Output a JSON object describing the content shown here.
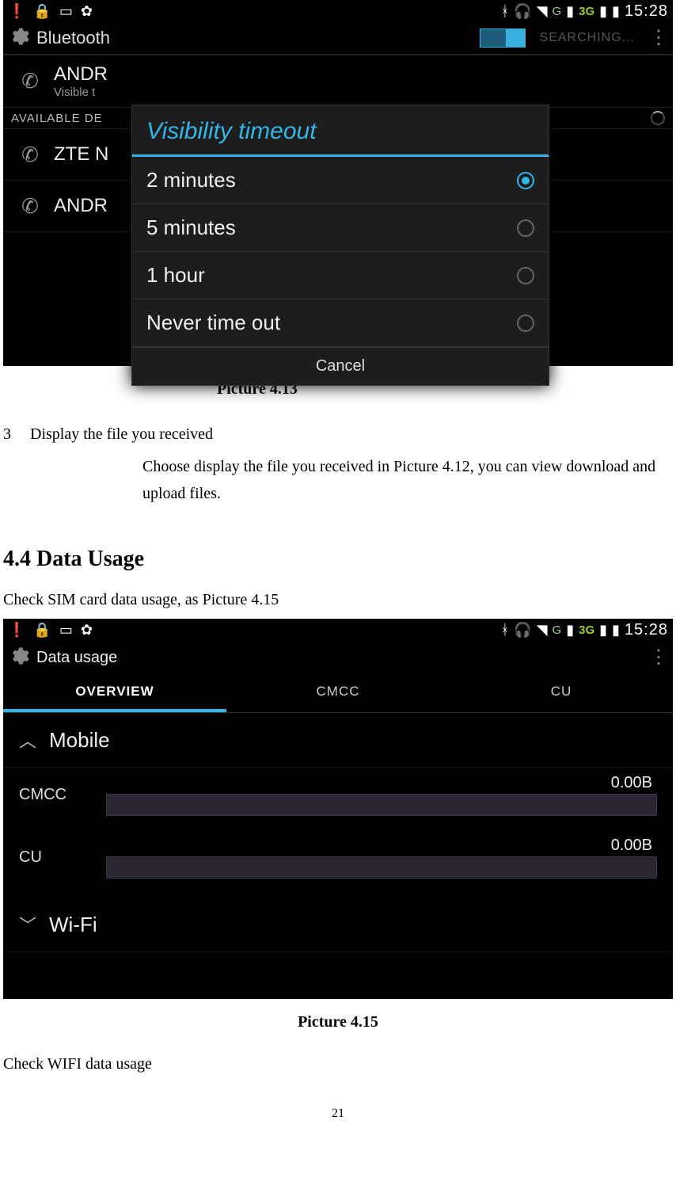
{
  "screenshot1": {
    "status": {
      "time": "15:28",
      "net3g": "3G",
      "netG": "G"
    },
    "header": {
      "title": "Bluetooth",
      "searching": "SEARCHING..."
    },
    "self_device": {
      "name": "ANDR",
      "sub": "Visible t"
    },
    "available_label": "AVAILABLE DE",
    "devices": [
      {
        "name": "ZTE N"
      },
      {
        "name": "ANDR"
      }
    ],
    "dialog": {
      "title": "Visibility timeout",
      "options": [
        {
          "label": "2 minutes",
          "selected": true
        },
        {
          "label": "5 minutes",
          "selected": false
        },
        {
          "label": "1 hour",
          "selected": false
        },
        {
          "label": "Never time out",
          "selected": false
        }
      ],
      "cancel": "Cancel"
    }
  },
  "caption1": "Picture 4.13",
  "list_number": "3",
  "list_title": "Display the file you received",
  "list_body": "Choose display the file you received in Picture 4.12, you can view download and upload files.",
  "heading": "4.4 Data Usage",
  "para1": "Check SIM card data usage, as Picture 4.15",
  "screenshot2": {
    "status": {
      "time": "15:28",
      "net3g": "3G",
      "netG": "G"
    },
    "header": {
      "title": "Data usage"
    },
    "tabs": [
      {
        "label": "OVERVIEW",
        "active": true
      },
      {
        "label": "CMCC",
        "active": false
      },
      {
        "label": "CU",
        "active": false
      }
    ],
    "section_mobile": "Mobile",
    "usage": [
      {
        "label": "CMCC",
        "value": "0.00B"
      },
      {
        "label": "CU",
        "value": "0.00B"
      }
    ],
    "section_wifi": "Wi-Fi"
  },
  "caption2": "Picture 4.15",
  "para2": "Check WIFI data usage",
  "page_number": "21"
}
